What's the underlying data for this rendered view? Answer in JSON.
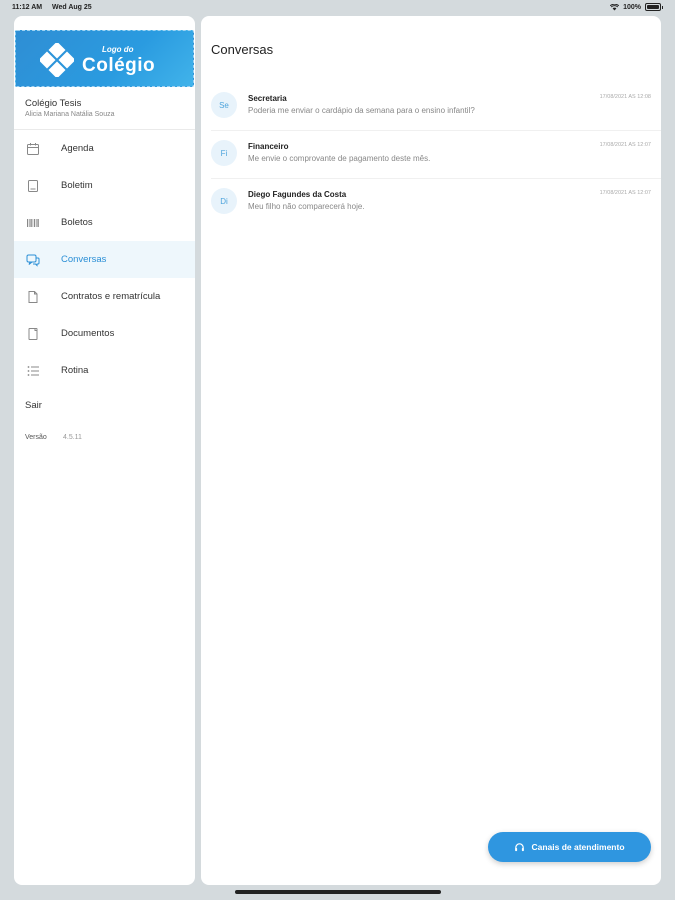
{
  "status_bar": {
    "time": "11:12 AM",
    "date": "Wed Aug 25",
    "battery": "100%"
  },
  "sidebar": {
    "logo_top": "Logo do",
    "logo_main": "Colégio",
    "school_name": "Colégio Tesis",
    "student_name": "Alicia Mariana Natália Souza",
    "items": [
      {
        "label": "Agenda",
        "icon": "calendar-icon"
      },
      {
        "label": "Boletim",
        "icon": "report-card-icon"
      },
      {
        "label": "Boletos",
        "icon": "barcode-icon"
      },
      {
        "label": "Conversas",
        "icon": "chat-icon",
        "active": true
      },
      {
        "label": "Contratos e rematrícula",
        "icon": "document-icon"
      },
      {
        "label": "Documentos",
        "icon": "file-icon"
      },
      {
        "label": "Rotina",
        "icon": "list-icon"
      }
    ],
    "logout_label": "Sair",
    "version_label": "Versão",
    "version_value": "4.5.11"
  },
  "main": {
    "title": "Conversas",
    "conversations": [
      {
        "initials": "Se",
        "name": "Secretaria",
        "message": "Poderia me enviar o cardápio da semana para o ensino infantil?",
        "date": "17/08/2021 AS 12:08"
      },
      {
        "initials": "Fi",
        "name": "Financeiro",
        "message": "Me envie o comprovante de pagamento deste mês.",
        "date": "17/08/2021 AS 12:07"
      },
      {
        "initials": "Di",
        "name": "Diego Fagundes da Costa",
        "message": "Meu filho não comparecerá hoje.",
        "date": "17/08/2021 AS 12:07"
      }
    ]
  },
  "fab": {
    "label": "Canais de atendimento",
    "icon": "headset-icon"
  },
  "colors": {
    "accent": "#2f96e0",
    "active_bg": "#eef7fc",
    "background": "#d4dadd"
  }
}
